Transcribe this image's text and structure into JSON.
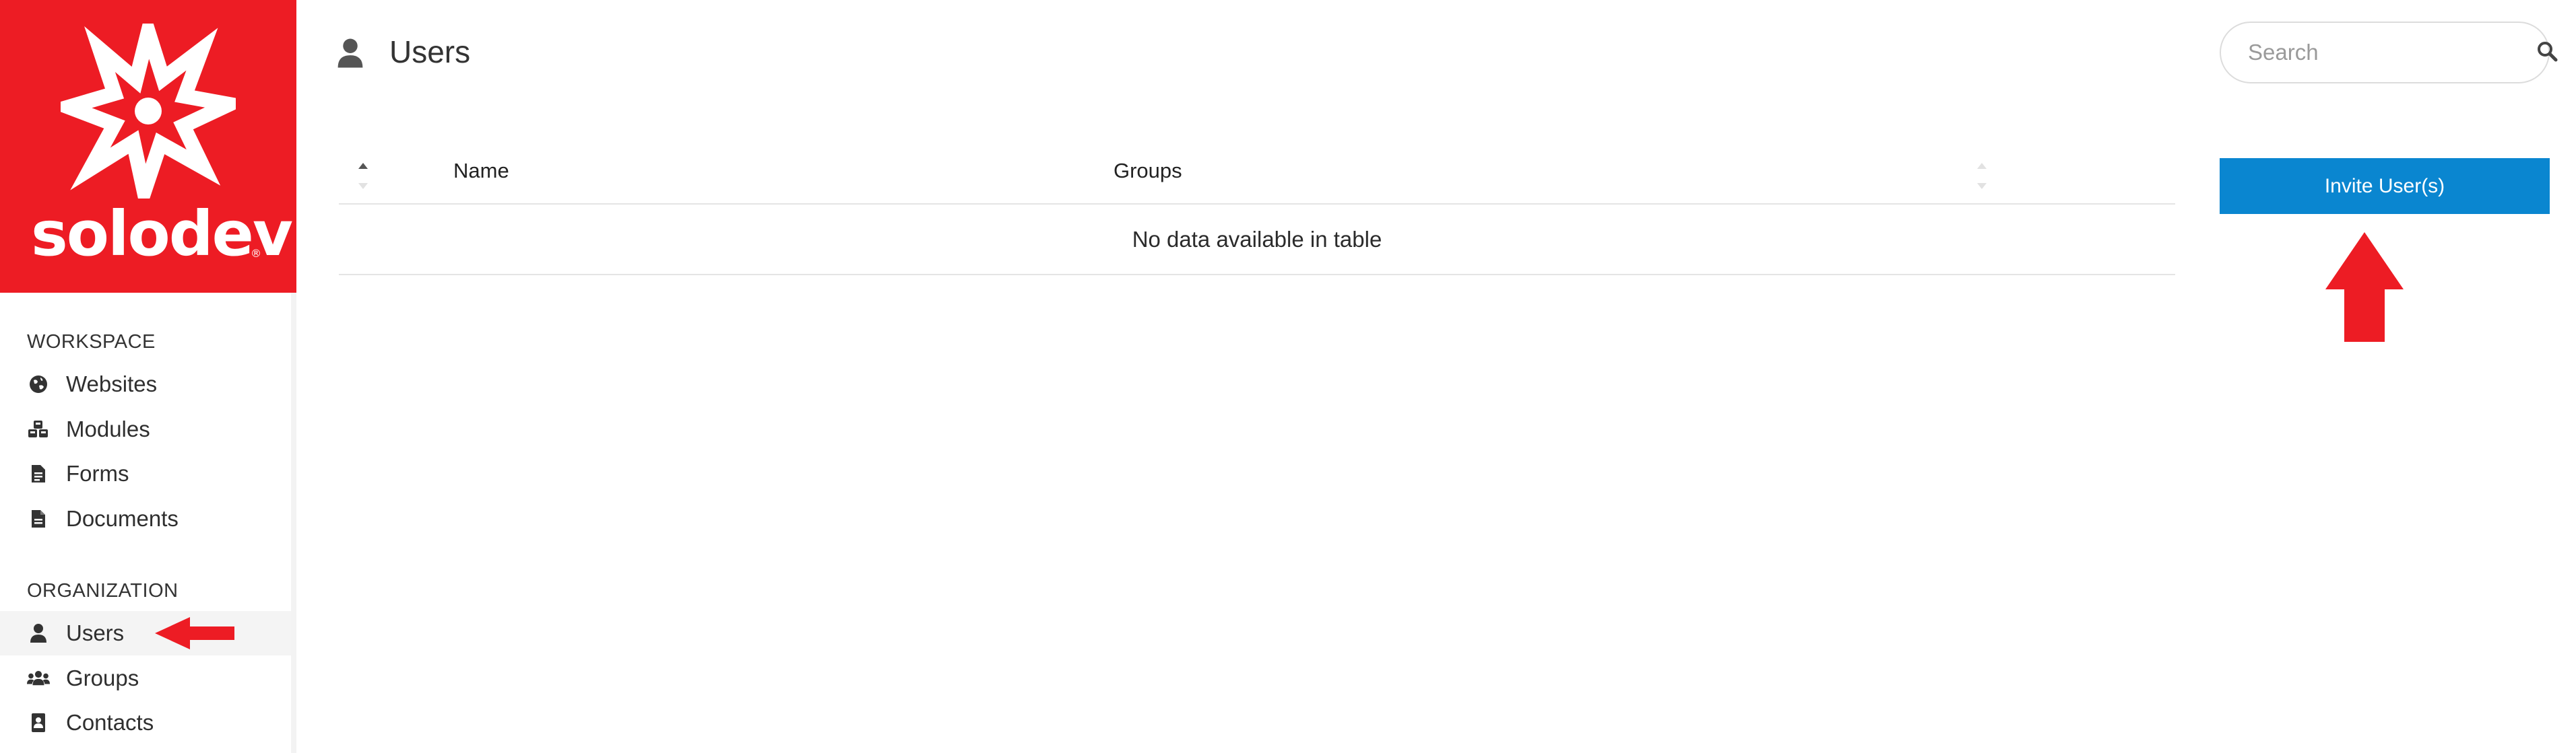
{
  "brand": {
    "wordmark": "solodev",
    "registered": "®",
    "color": "#ed1c24"
  },
  "sidebar": {
    "sections": [
      {
        "title": "WORKSPACE",
        "items": [
          {
            "label": "Websites",
            "icon": "globe-icon"
          },
          {
            "label": "Modules",
            "icon": "cubes-icon"
          },
          {
            "label": "Forms",
            "icon": "file-form-icon"
          },
          {
            "label": "Documents",
            "icon": "document-icon"
          }
        ]
      },
      {
        "title": "ORGANIZATION",
        "items": [
          {
            "label": "Users",
            "icon": "user-icon",
            "active": true
          },
          {
            "label": "Groups",
            "icon": "users-group-icon"
          },
          {
            "label": "Contacts",
            "icon": "address-book-icon"
          }
        ]
      }
    ]
  },
  "header": {
    "title": "Users",
    "icon": "user-icon"
  },
  "search": {
    "placeholder": "Search",
    "value": ""
  },
  "table": {
    "columns": [
      "Name",
      "Groups"
    ],
    "empty_message": "No data available in table",
    "rows": []
  },
  "actions": {
    "invite_label": "Invite User(s)",
    "accent": "#0a86d0"
  },
  "annotations": {
    "arrow_color": "#ed1c24"
  }
}
